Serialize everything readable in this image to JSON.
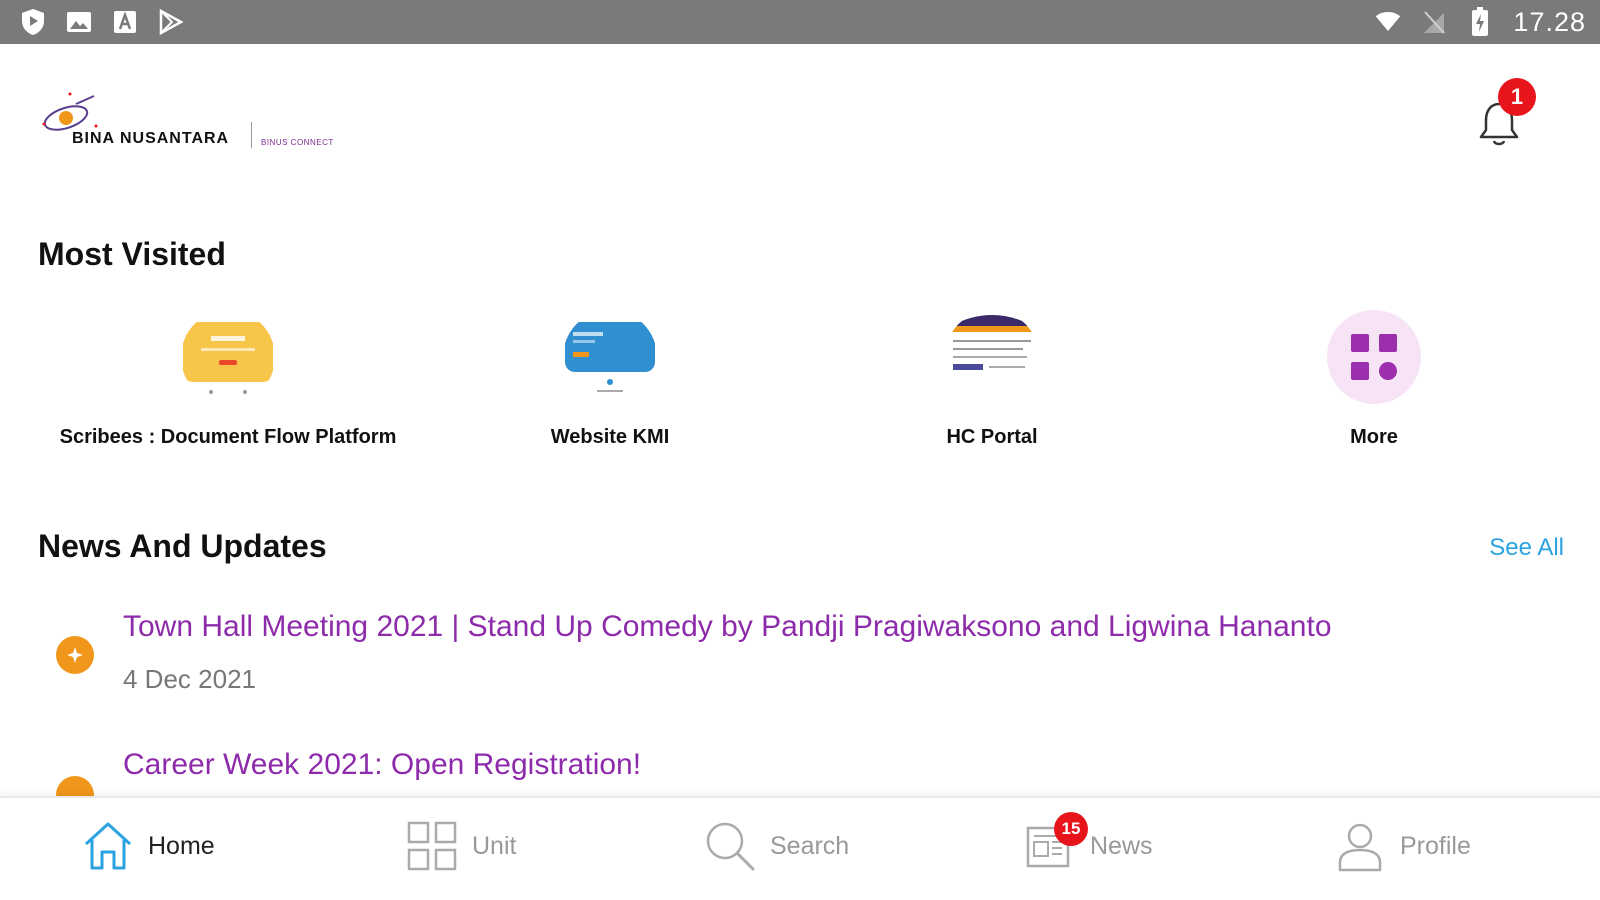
{
  "status_bar": {
    "time": "17.28",
    "left_icons": [
      "shield-icon",
      "image-icon",
      "a-box-icon",
      "play-store-icon"
    ],
    "right_icons": [
      "wifi-icon",
      "no-signal-icon",
      "battery-charging-icon"
    ]
  },
  "header": {
    "logo_text": "BINA NUSANTARA",
    "logo_subtext": "BINUS CONNECT",
    "notification_count": "1"
  },
  "most_visited": {
    "title": "Most Visited",
    "items": [
      {
        "label": "Scribees : Document Flow Platform",
        "icon": "scribees-thumbnail"
      },
      {
        "label": "Website KMI",
        "icon": "kmi-thumbnail"
      },
      {
        "label": "HC Portal",
        "icon": "hc-portal-thumbnail"
      },
      {
        "label": "More",
        "icon": "grid-icon"
      }
    ]
  },
  "news": {
    "title": "News And Updates",
    "see_all": "See All",
    "items": [
      {
        "title": "Town Hall Meeting 2021 | Stand Up Comedy by Pandji Pragiwaksono and Ligwina Hananto",
        "date": "4 Dec 2021"
      },
      {
        "title": "Career Week 2021: Open Registration!",
        "date": ""
      }
    ]
  },
  "bottom_nav": {
    "items": [
      {
        "label": "Home",
        "icon": "home-icon",
        "active": true
      },
      {
        "label": "Unit",
        "icon": "unit-grid-icon",
        "active": false
      },
      {
        "label": "Search",
        "icon": "search-icon",
        "active": false
      },
      {
        "label": "News",
        "icon": "news-icon",
        "active": false,
        "badge": "15"
      },
      {
        "label": "Profile",
        "icon": "profile-icon",
        "active": false
      }
    ]
  },
  "colors": {
    "status_bar": "#7a7a7a",
    "accent_purple": "#8d2bab",
    "link_blue": "#2aa3e0",
    "badge_red": "#e8141b",
    "bullet_orange": "#f0961a"
  }
}
